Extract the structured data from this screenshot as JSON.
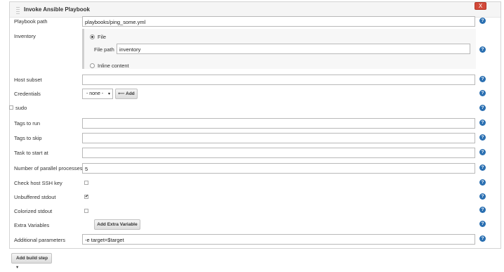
{
  "section": {
    "title": "Invoke Ansible Playbook",
    "close_label": "X"
  },
  "fields": {
    "playbook_path": {
      "label": "Playbook path",
      "value": "playbooks/ping_some.yml"
    },
    "inventory": {
      "label": "Inventory",
      "file_option": "File",
      "file_path_label": "File path",
      "file_path_value": "inventory",
      "inline_option": "Inline content",
      "selected": "File"
    },
    "host_subset": {
      "label": "Host subset",
      "value": ""
    },
    "credentials": {
      "label": "Credentials",
      "selected": "- none -",
      "add_label": "Add"
    },
    "sudo": {
      "label": "sudo",
      "checked": false
    },
    "tags_to_run": {
      "label": "Tags to run",
      "value": ""
    },
    "tags_to_skip": {
      "label": "Tags to skip",
      "value": ""
    },
    "task_to_start_at": {
      "label": "Task to start at",
      "value": ""
    },
    "parallel": {
      "label": "Number of parallel processes",
      "value": "5"
    },
    "check_host_ssh_key": {
      "label": "Check host SSH key",
      "checked": false
    },
    "unbuffered_stdout": {
      "label": "Unbuffered stdout",
      "checked": true
    },
    "colorized_stdout": {
      "label": "Colorized stdout",
      "checked": false
    },
    "extra_variables": {
      "label": "Extra Variables",
      "button_label": "Add Extra Variable"
    },
    "additional_parameters": {
      "label": "Additional parameters",
      "value": "-e target=$target"
    }
  },
  "footer": {
    "add_build_step_label": "Add build step"
  },
  "icons": {
    "help": "help-icon",
    "close": "close-icon",
    "add_key": "key-icon",
    "dropdown": "chevron-down-icon"
  },
  "colors": {
    "help_blue": "#2a6fb1",
    "close_red": "#d24939"
  }
}
